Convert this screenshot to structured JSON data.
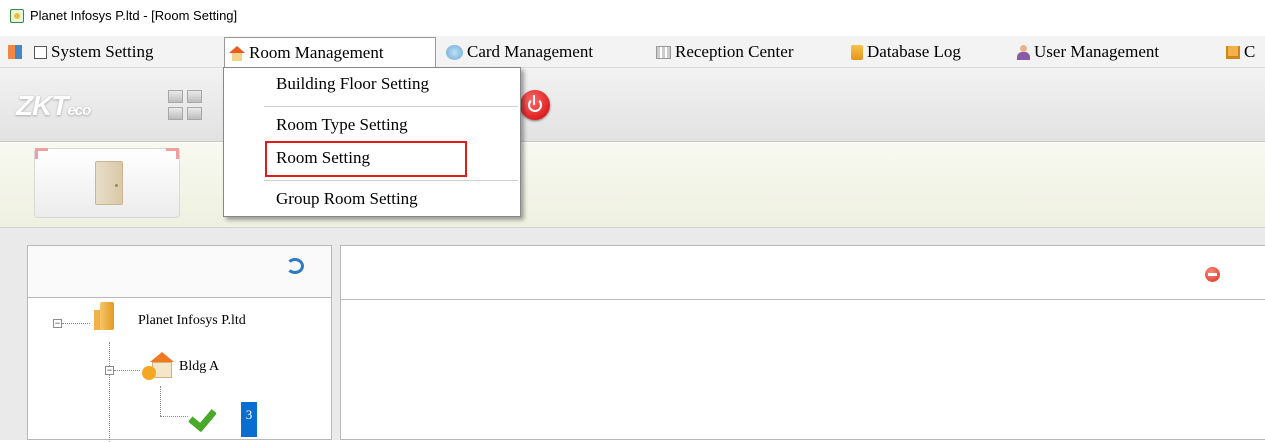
{
  "window": {
    "title": "Planet Infosys P.ltd - [Room Setting]"
  },
  "menubar": {
    "items": [
      {
        "label": "System Setting",
        "icon": "system-setting-icon"
      },
      {
        "label": "Room Management",
        "icon": "house-icon"
      },
      {
        "label": "Card Management",
        "icon": "card-icon"
      },
      {
        "label": "Reception Center",
        "icon": "reception-icon"
      },
      {
        "label": "Database Log",
        "icon": "database-log-icon"
      },
      {
        "label": "User Management",
        "icon": "user-icon"
      },
      {
        "label": "C",
        "icon": "cart-icon"
      }
    ]
  },
  "room_menu": {
    "items": [
      {
        "label": "Building  Floor Setting"
      },
      {
        "label": "Room Type Setting"
      },
      {
        "label": "Room Setting",
        "highlighted": true
      },
      {
        "label": "Group Room Setting"
      }
    ]
  },
  "toolbar": {
    "logo_text": "ZKT",
    "logo_suffix": "eco"
  },
  "tree": {
    "root": {
      "label": "Planet Infosys P.ltd"
    },
    "building": {
      "label": "Bldg A"
    },
    "room": {
      "label": "3"
    }
  },
  "colors": {
    "highlight": "#e21a1a",
    "selection": "#0a6ed1"
  }
}
